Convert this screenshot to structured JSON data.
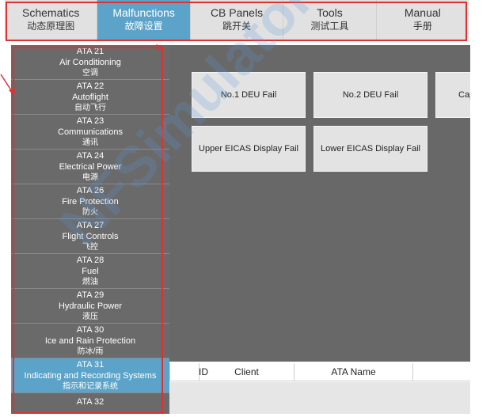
{
  "tabs": [
    {
      "en": "Schematics",
      "zh": "动态原理图",
      "active": false
    },
    {
      "en": "Malfunctions",
      "zh": "故障设置",
      "active": true
    },
    {
      "en": "CB Panels",
      "zh": "跳开关",
      "active": false
    },
    {
      "en": "Tools",
      "zh": "测试工具",
      "active": false
    },
    {
      "en": "Manual",
      "zh": "手册",
      "active": false
    }
  ],
  "sidebar": {
    "items": [
      {
        "code": "ATA 21",
        "en": "Air Conditioning",
        "zh": "空调"
      },
      {
        "code": "ATA 22",
        "en": "Autoflight",
        "zh": "自动飞行"
      },
      {
        "code": "ATA 23",
        "en": "Communications",
        "zh": "通讯"
      },
      {
        "code": "ATA 24",
        "en": "Electrical Power",
        "zh": "电源"
      },
      {
        "code": "ATA 26",
        "en": "Fire Protection",
        "zh": "防火"
      },
      {
        "code": "ATA 27",
        "en": "Flight Controls",
        "zh": "飞控"
      },
      {
        "code": "ATA 28",
        "en": "Fuel",
        "zh": "燃油"
      },
      {
        "code": "ATA 29",
        "en": "Hydraulic Power",
        "zh": "液压"
      },
      {
        "code": "ATA 30",
        "en": "Ice and Rain Protection",
        "zh": "防冰/雨"
      },
      {
        "code": "ATA 31",
        "en": "Indicating and Recording Systems",
        "zh": "指示和记录系统",
        "active": true
      },
      {
        "code": "ATA 32",
        "en": "",
        "zh": ""
      }
    ]
  },
  "malfunctions": {
    "buttons": [
      {
        "label": "No.1 DEU Fail"
      },
      {
        "label": "No.2 DEU Fail"
      },
      {
        "label": "Cap"
      },
      {
        "label": "Upper EICAS Display Fail"
      },
      {
        "label": "Lower EICAS Display Fail"
      }
    ]
  },
  "table": {
    "columns": [
      "ID",
      "Client",
      "ATA Name"
    ]
  },
  "watermark": "NFSimulator",
  "colors": {
    "accent": "#5ca3c9",
    "sidebar": "#6a6a6a",
    "content": "#686868",
    "annotation": "#e03030"
  }
}
